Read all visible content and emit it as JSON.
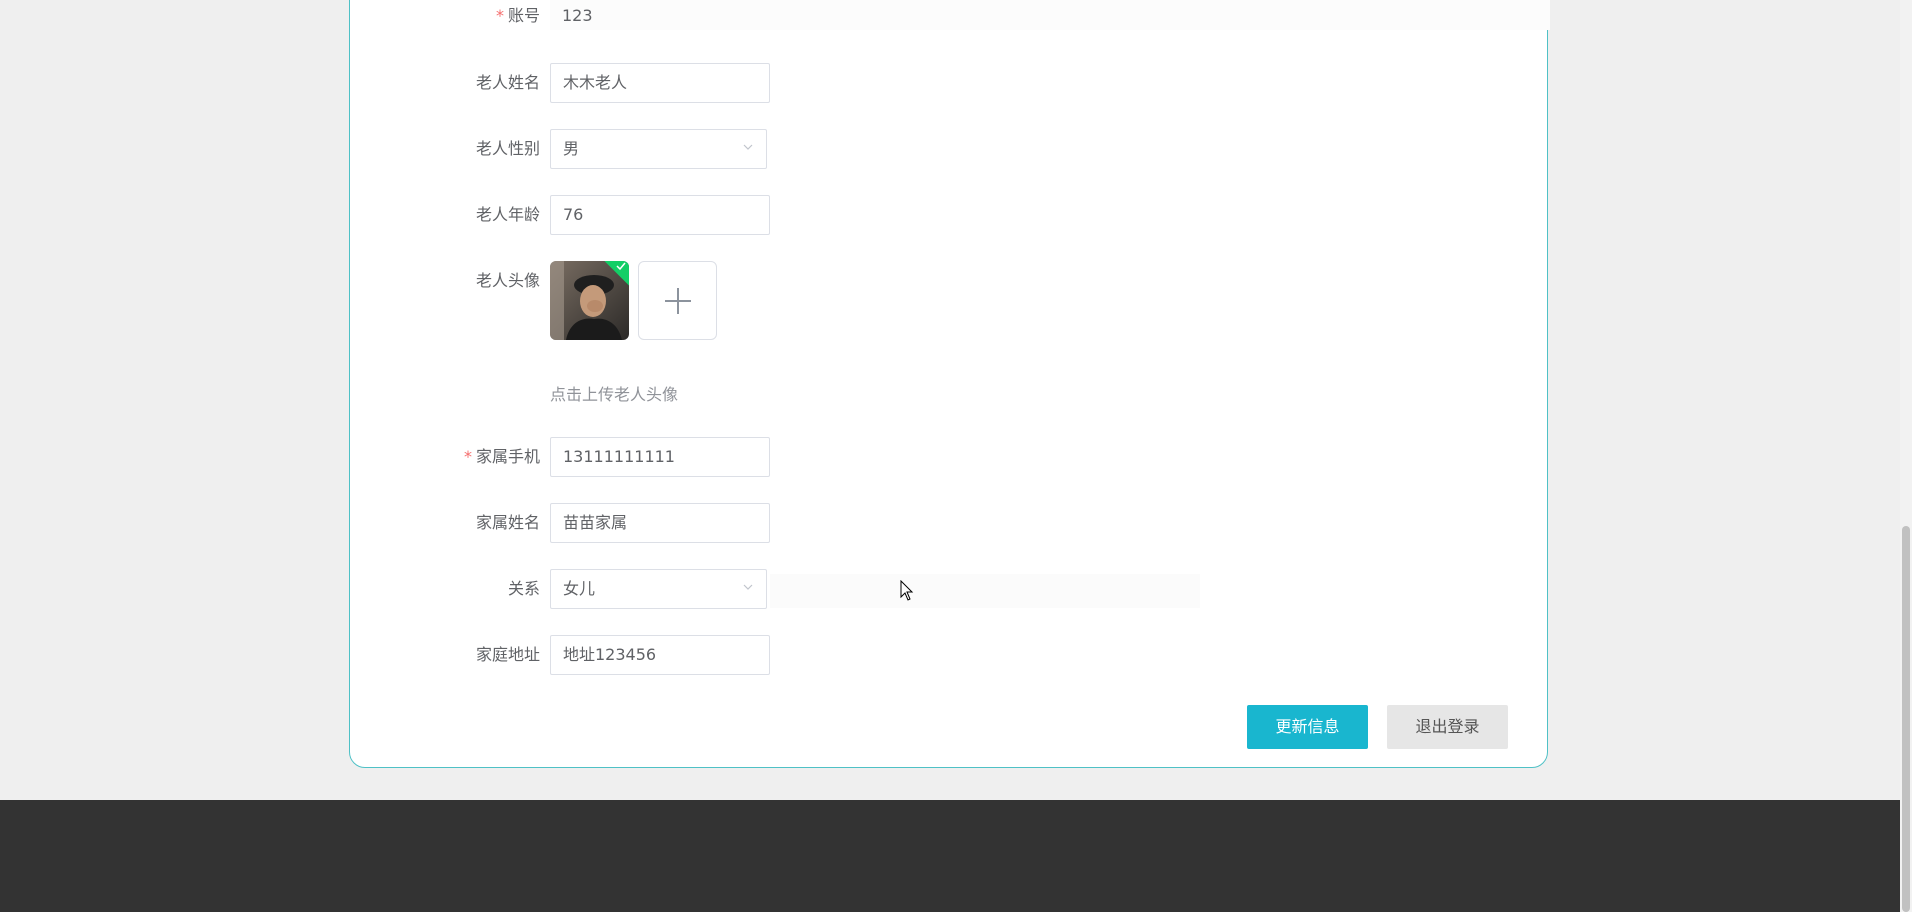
{
  "form": {
    "account": {
      "label": "账号",
      "value": "123",
      "required": true
    },
    "elder_name": {
      "label": "老人姓名",
      "value": "木木老人"
    },
    "elder_gender": {
      "label": "老人性别",
      "value": "男"
    },
    "elder_age": {
      "label": "老人年龄",
      "value": "76"
    },
    "elder_avatar": {
      "label": "老人头像",
      "hint": "点击上传老人头像"
    },
    "family_phone": {
      "label": "家属手机",
      "value": "13111111111",
      "required": true
    },
    "family_name": {
      "label": "家属姓名",
      "value": "苗苗家属"
    },
    "relation": {
      "label": "关系",
      "value": "女儿"
    },
    "address": {
      "label": "家庭地址",
      "value": "地址123456"
    }
  },
  "buttons": {
    "update": "更新信息",
    "logout": "退出登录"
  },
  "icons": {
    "upload_add": "plus-icon",
    "upload_success": "check-icon",
    "select_arrow": "chevron-down-icon"
  },
  "colors": {
    "primary": "#19b6cf",
    "card_border": "#4fc1c6",
    "required": "#f56c6c",
    "success_badge": "#13ce66",
    "footer": "#333333"
  }
}
